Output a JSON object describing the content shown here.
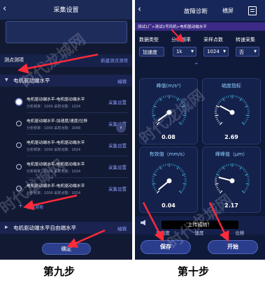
{
  "left": {
    "title": "采集设置",
    "measure_points_label": "测点测项",
    "new_point_label": "新建测点测项",
    "group1": {
      "name": "电机驱动端水平",
      "edit_label": "编辑"
    },
    "items": [
      {
        "name": "电机驱动端水平-电机驱动端水平",
        "meta": "分析频率：1000   采样点数：1024",
        "action": "采集设置",
        "checked": true
      },
      {
        "name": "电机驱动端水平-加速度/速度/位移",
        "meta": "分析频率：1000   采样点数：2048",
        "action": "采集设置",
        "checked": false
      },
      {
        "name": "电机驱动端水平-电机驱动端水平",
        "meta": "分析频率：1000   采样点数：1024",
        "action": "采集设置",
        "checked": false
      },
      {
        "name": "电机驱动端水平-电机驱动端水平",
        "meta": "分析频率：1000   采样点数：1024",
        "action": "采集设置",
        "checked": false
      },
      {
        "name": "电机驱动端水平-电机驱动端水平",
        "meta": "分析频率：1000   采样点数：1024",
        "action": "采集设置",
        "checked": false
      }
    ],
    "add_item_label": "新增测项",
    "group2": {
      "name": "电机驱动端水平自由端水平",
      "edit_label": "编辑"
    },
    "confirm_label": "确定",
    "caption": "第九步"
  },
  "right": {
    "title": "故障诊断",
    "screen_label": "横屏",
    "breadcrumb": "测试1厂>测试1号风机>电机驱动端水平",
    "selectors": [
      {
        "label": "数据类型",
        "value": "加速度"
      },
      {
        "label": "分析频率",
        "value": "1k"
      },
      {
        "label": "采样点数",
        "value": "1024"
      },
      {
        "label": "转速采集",
        "value": "否"
      }
    ],
    "gauges": [
      {
        "title": "峰值(m/s²)",
        "value": "0.08",
        "level": 0.03
      },
      {
        "title": "峭度指标",
        "value": "2.69",
        "level": 0.27
      },
      {
        "title": "有效值（mm/s）",
        "value": "0.04",
        "level": 0.02
      },
      {
        "title": "峰峰值（μm）",
        "value": "2.17",
        "level": 0.22
      }
    ],
    "tabs": [
      "加速度",
      "速度",
      "位移"
    ],
    "toast": "上传成功！",
    "save_label": "保存",
    "start_label": "开始",
    "caption": "第十步"
  },
  "watermark": "时代龙城网"
}
